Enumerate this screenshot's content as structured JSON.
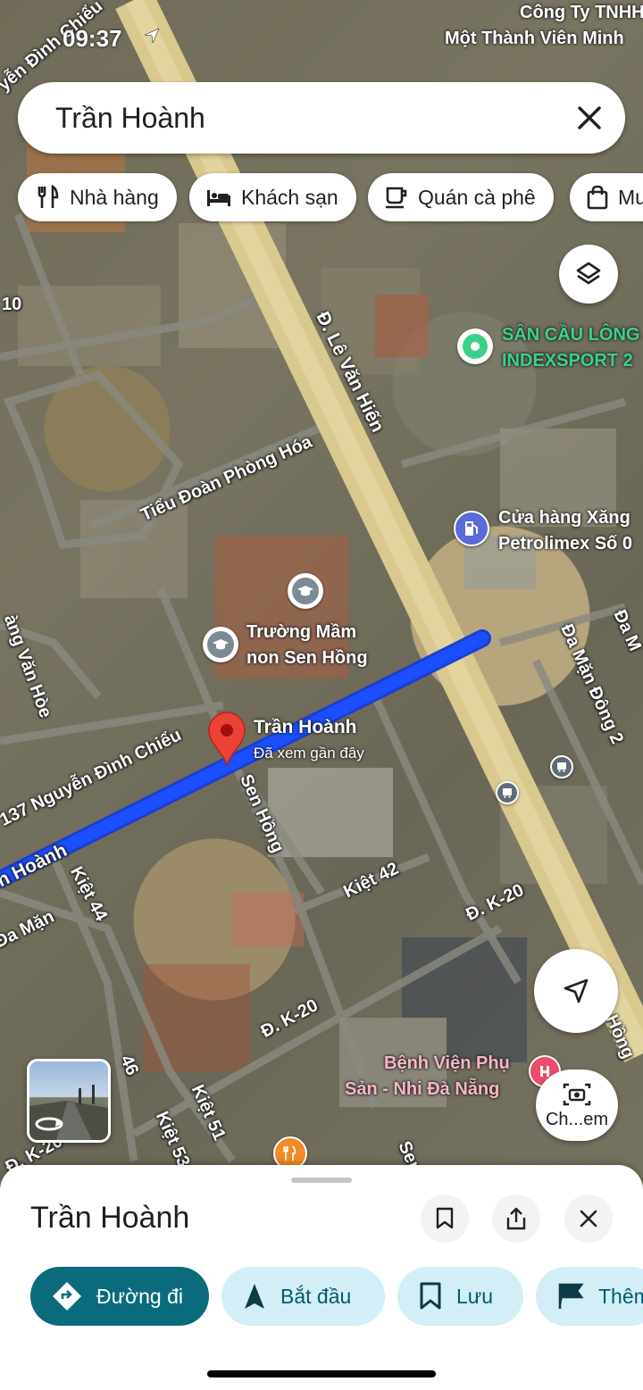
{
  "status_bar": {
    "time": "09:37"
  },
  "search": {
    "query": "Trần Hoành"
  },
  "chips": [
    {
      "label": "Nhà hàng",
      "icon": "restaurant-icon"
    },
    {
      "label": "Khách sạn",
      "icon": "hotel-icon"
    },
    {
      "label": "Quán cà phê",
      "icon": "coffee-icon"
    },
    {
      "label": "Mu",
      "icon": "shopping-bag-icon"
    }
  ],
  "map": {
    "streets": {
      "le_van_hien": "Đ. Lê Văn Hiến",
      "tieu_doan": "Tiểu Đoàn Phòng Hóa",
      "nguyen_dinh_chieu": "Nguyễn Đình Chiều",
      "nguyen_dinh_chieu_top": "yễn Đình Chiểu",
      "address_137": "137 Nguyễn Đình Chiểu",
      "tran_hoanh_street": "n Hoành",
      "kiet44": "Kiệt 44",
      "kiet42": "Kiệt 42",
      "kiet51": "Kiệt 51",
      "kiet53": "Kiệt 53",
      "k20_a": "Đ. K-20",
      "k20_b": "Đ. K-20",
      "k20_c": "Đ. K-20",
      "da_man": "Đa Mặn",
      "da_man_dong2": "Đa Mặn Đông 2",
      "sen_hong": "Sen Hồng",
      "hoang_van_hoe": "àng Văn Hòe",
      "sen_bottom": "Sen",
      "num10": "10",
      "num46": "46",
      "da_m": "Đa M",
      "hong_right": "Hồng"
    },
    "pois": {
      "cong_ty_1": "Công Ty TNHH",
      "cong_ty_2": "Một Thành Viên Minh",
      "san_cau_long_1": "SÂN CẦU LÔNG",
      "san_cau_long_2": "INDEXSPORT 2",
      "cua_hang_1": "Cửa hàng Xăng",
      "cua_hang_2": "Petrolimex Số 0",
      "truong_1": "Trường Mầm",
      "truong_2": "non Sen Hồng",
      "benh_vien_1": "Bệnh Viện Phụ",
      "benh_vien_2": "Sản - Nhi Đà Nẵng"
    },
    "selected_pin": {
      "name": "Trần Hoành",
      "subtitle": "Đã xem gần đây"
    },
    "colors": {
      "route": "#1a4fff",
      "pin": "#ea4335",
      "poi_green": "#3bd18b",
      "fuel": "#5b6bd5"
    }
  },
  "controls": {
    "layers_icon": "layers-icon",
    "my_location_icon": "navigation-arrow-icon",
    "camera_label": "Ch...em"
  },
  "sheet": {
    "title": "Trần Hoành",
    "actions": [
      {
        "label": "Đường đi",
        "icon": "directions-icon"
      },
      {
        "label": "Bắt đầu",
        "icon": "navigation-icon"
      },
      {
        "label": "Lưu",
        "icon": "bookmark-icon"
      },
      {
        "label": "Thêm",
        "icon": "flag-icon"
      }
    ],
    "accent": "#0b6b7d"
  }
}
